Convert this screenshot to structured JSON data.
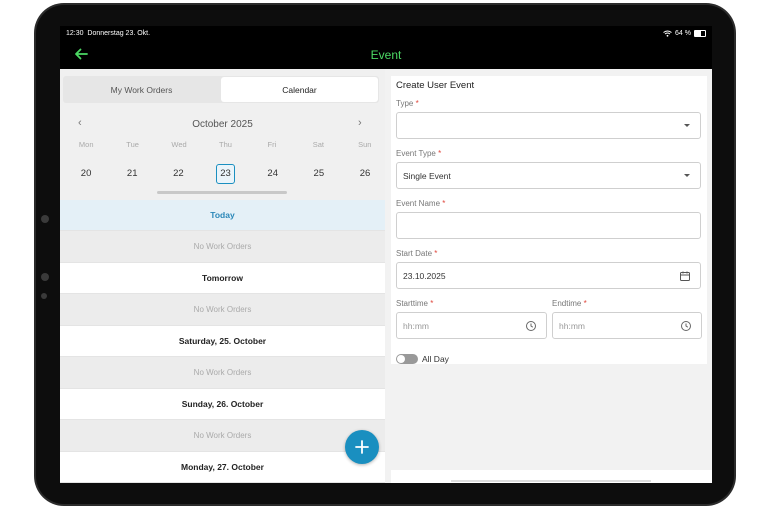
{
  "status_bar": {
    "time": "12:30",
    "date": "Donnerstag 23. Okt.",
    "battery": "64 %"
  },
  "header": {
    "title": "Event"
  },
  "tabs": [
    {
      "label": "My Work Orders",
      "active": false
    },
    {
      "label": "Calendar",
      "active": true
    }
  ],
  "calendar": {
    "month_label": "October 2025",
    "weekdays": [
      "Mon",
      "Tue",
      "Wed",
      "Thu",
      "Fri",
      "Sat",
      "Sun"
    ],
    "days": [
      "20",
      "21",
      "22",
      "23",
      "24",
      "25",
      "26"
    ],
    "selected_day": "23"
  },
  "work_orders": {
    "empty_text": "No Work Orders",
    "groups": [
      {
        "heading": "Today",
        "is_today": true
      },
      {
        "heading": "Tomorrow",
        "is_today": false
      },
      {
        "heading": "Saturday, 25. October",
        "is_today": false
      },
      {
        "heading": "Sunday, 26. October",
        "is_today": false
      },
      {
        "heading": "Monday, 27. October",
        "is_today": false
      }
    ]
  },
  "form": {
    "title": "Create User Event",
    "type": {
      "label": "Type",
      "value": ""
    },
    "event_type": {
      "label": "Event Type",
      "value": "Single Event"
    },
    "event_name": {
      "label": "Event Name",
      "value": ""
    },
    "start_date": {
      "label": "Start Date",
      "value": "23.10.2025"
    },
    "starttime": {
      "label": "Starttime",
      "placeholder": "hh:mm"
    },
    "endtime": {
      "label": "Endtime",
      "placeholder": "hh:mm"
    },
    "all_day": {
      "label": "All Day",
      "checked": false
    },
    "required_marker": "*"
  },
  "colors": {
    "accent": "#1a8fc0",
    "header_title": "#4cd964",
    "required": "#e0473c"
  },
  "icons": {
    "back": "arrow-left-icon",
    "add": "plus-icon",
    "calendar": "calendar-icon",
    "clock": "clock-icon"
  }
}
